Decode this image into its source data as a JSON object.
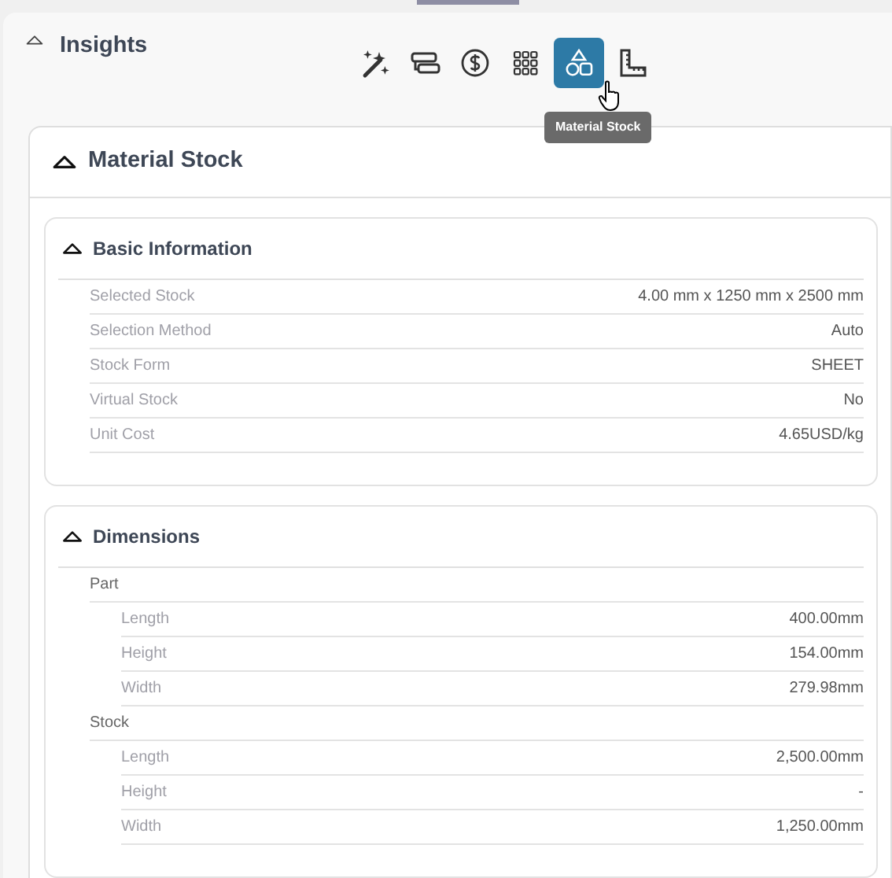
{
  "panel": {
    "title": "Insights",
    "expanded": true
  },
  "toolbar": [
    {
      "kind": "wand",
      "selected": false
    },
    {
      "kind": "layers",
      "selected": false
    },
    {
      "kind": "dollar",
      "selected": false
    },
    {
      "kind": "grid",
      "selected": false
    },
    {
      "kind": "shapes",
      "selected": true
    },
    {
      "kind": "ruler",
      "selected": false
    }
  ],
  "tooltip": "Material Stock",
  "card": {
    "title": "Material Stock",
    "expanded": true
  },
  "sections": [
    {
      "title": "Basic Information",
      "expanded": true,
      "rows": [
        {
          "label": "Selected Stock",
          "value": "4.00 mm x 1250 mm x 2500 mm"
        },
        {
          "label": "Selection Method",
          "value": "Auto"
        },
        {
          "label": "Stock Form",
          "value": "SHEET"
        },
        {
          "label": "Virtual Stock",
          "value": "No"
        },
        {
          "label": "Unit Cost",
          "value": "4.65USD/kg"
        }
      ]
    },
    {
      "title": "Dimensions",
      "expanded": true,
      "groups": [
        {
          "label": "Part",
          "rows": [
            {
              "label": "Length",
              "value": "400.00mm"
            },
            {
              "label": "Height",
              "value": "154.00mm"
            },
            {
              "label": "Width",
              "value": "279.98mm"
            }
          ]
        },
        {
          "label": "Stock",
          "rows": [
            {
              "label": "Length",
              "value": "2,500.00mm"
            },
            {
              "label": "Height",
              "value": "-"
            },
            {
              "label": "Width",
              "value": "1,250.00mm"
            }
          ]
        }
      ]
    }
  ]
}
